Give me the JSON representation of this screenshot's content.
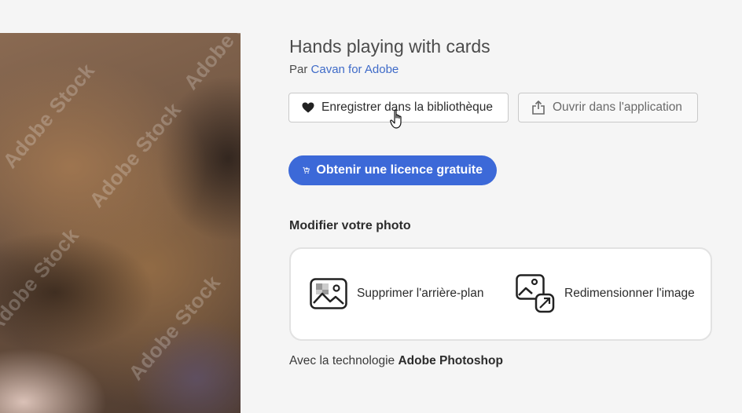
{
  "preview": {
    "watermark": "Adobe Stock"
  },
  "asset": {
    "title": "Hands playing with cards",
    "by_prefix": "Par",
    "author": "Cavan for Adobe"
  },
  "actions": {
    "save_label": "Enregistrer dans la bibliothèque",
    "open_label": "Ouvrir dans l'application",
    "license_label": "Obtenir une licence gratuite"
  },
  "edit": {
    "heading": "Modifier votre photo",
    "tools": [
      {
        "label": "Supprimer l'arrière-plan",
        "icon": "remove-background-icon"
      },
      {
        "label": "Redimensionner l'image",
        "icon": "resize-image-icon"
      }
    ]
  },
  "footer": {
    "prefix": "Avec la technologie",
    "brand": "Adobe Photoshop"
  },
  "colors": {
    "accent": "#3c69d8",
    "link": "#3f6bc8",
    "background": "#f5f5f5"
  }
}
